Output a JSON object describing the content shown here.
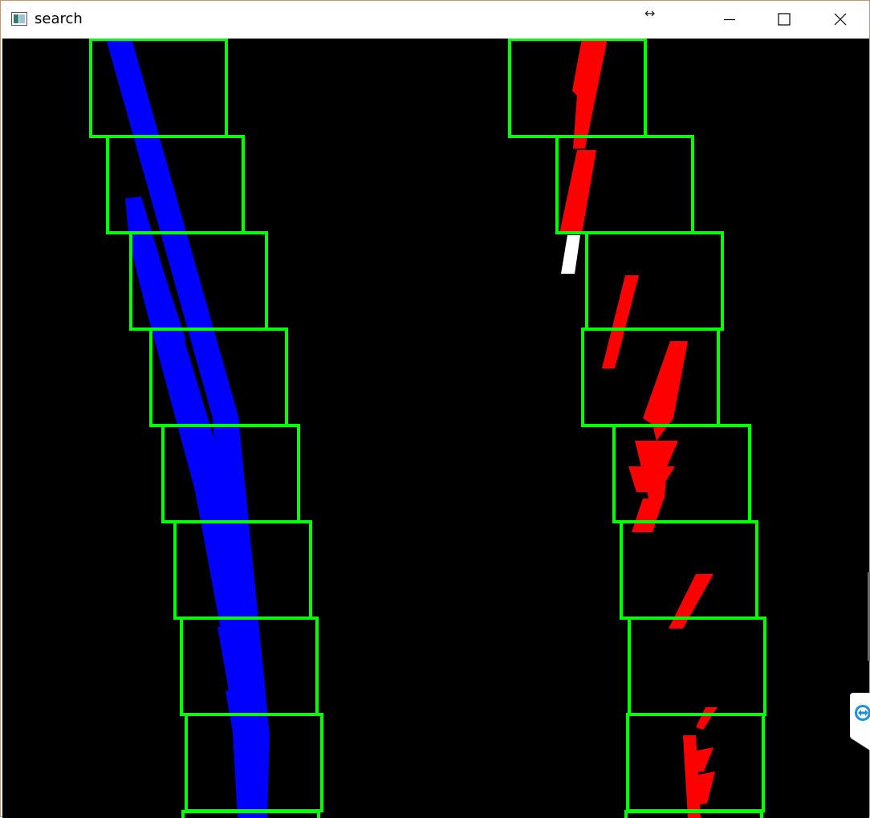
{
  "window": {
    "title": "search",
    "icons": {
      "app": "image-viewer-icon",
      "resize": "horizontal-resize-icon",
      "minimize": "minimize-icon",
      "maximize": "maximize-icon",
      "close": "close-icon",
      "side_widget": "remote-control-icon"
    }
  },
  "colors": {
    "background": "#000000",
    "search_window": "#00ff00",
    "left_lane": "#0000ff",
    "right_lane": "#ff0000",
    "unassigned": "#ffffff"
  }
}
